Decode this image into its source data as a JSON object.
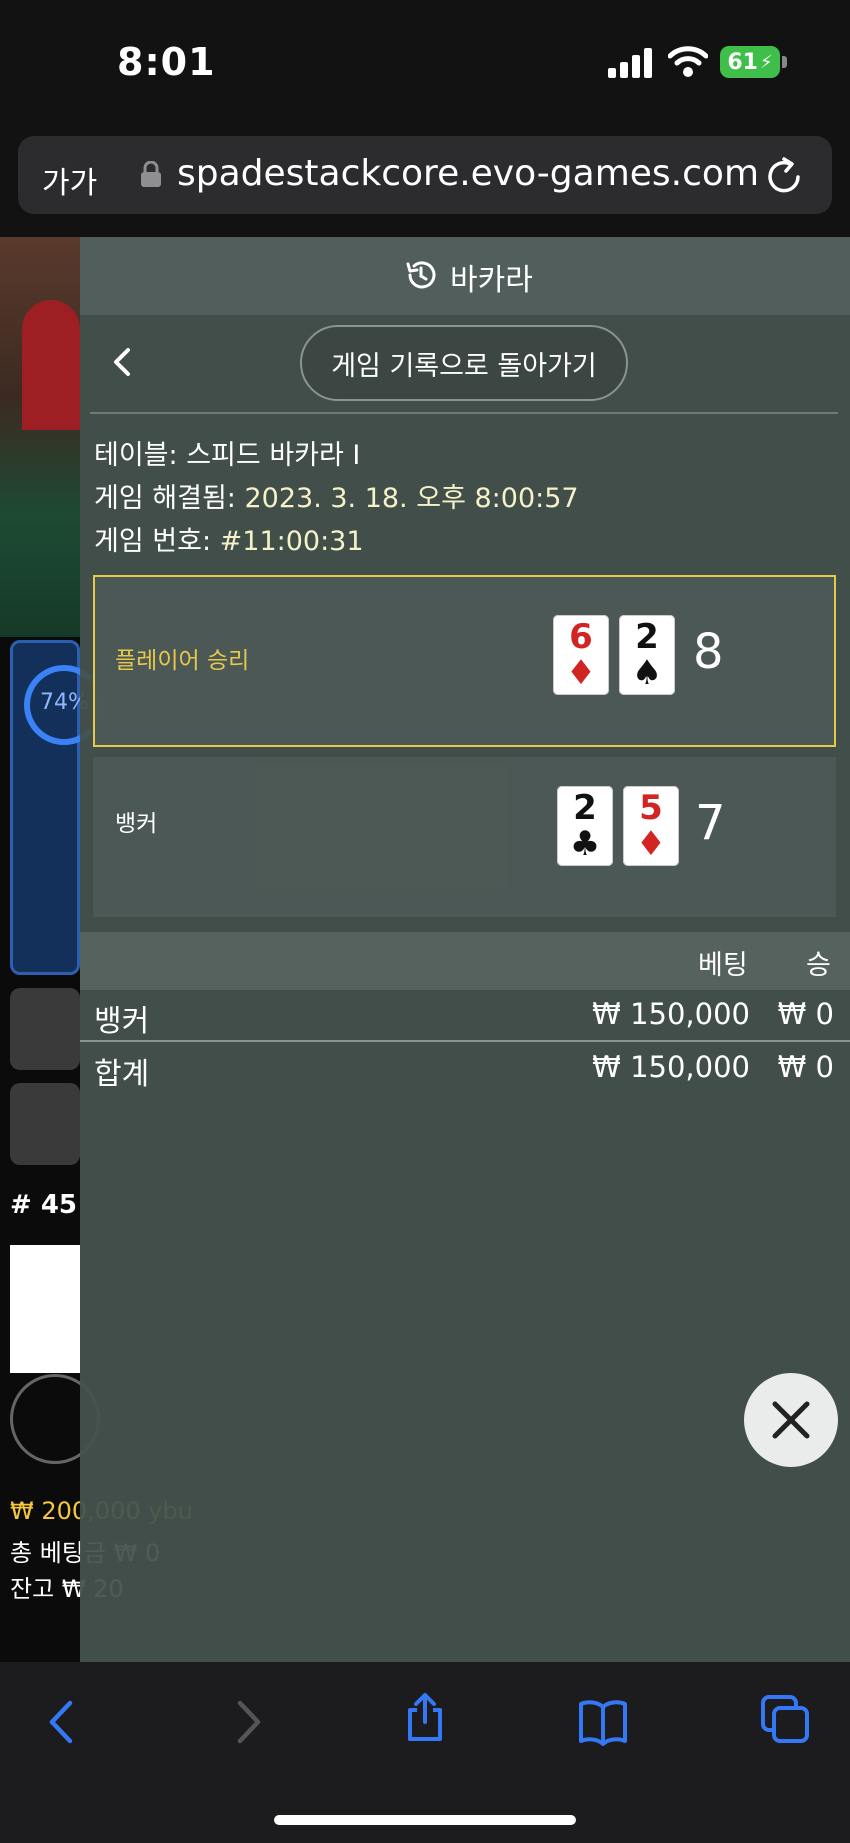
{
  "status_bar": {
    "time": "8:01",
    "battery": "61"
  },
  "browser": {
    "text_size": "가가",
    "url": "spadestackcore.evo-games.com"
  },
  "background": {
    "progress_percent": "74%",
    "round_number": "# 45",
    "balance_line1": "₩ 200,000 ybu",
    "balance_line2": "총 베팅금 ₩ 0",
    "balance_line3": "잔고 ₩ 20"
  },
  "panel": {
    "title": "바카라",
    "back_label": "게임 기록으로 돌아가기",
    "table_label": "테이블:",
    "table_value": "스피드 바카라 I",
    "resolved_label": "게임 해결됨:",
    "resolved_value": "2023. 3. 18. 오후 8:00:57",
    "number_label": "게임 번호:",
    "number_value": "#11:00:31"
  },
  "results": {
    "player": {
      "label": "플레이어 승리",
      "cards": [
        {
          "rank": "6",
          "suit": "♦"
        },
        {
          "rank": "2",
          "suit": "♠"
        }
      ],
      "score": "8"
    },
    "banker": {
      "label": "뱅커",
      "cards": [
        {
          "rank": "2",
          "suit": "♣"
        },
        {
          "rank": "5",
          "suit": "♦"
        }
      ],
      "score": "7"
    }
  },
  "bets": {
    "col_bet": "베팅",
    "col_win": "승",
    "rows": [
      {
        "name": "뱅커",
        "bet": "₩ 150,000",
        "win": "₩ 0"
      }
    ],
    "total": {
      "name": "합계",
      "bet": "₩ 150,000",
      "win": "₩ 0"
    }
  },
  "colors": {
    "accent_gold": "#e6c84a",
    "panel_bg": "#44524e",
    "link_blue": "#3478f6"
  },
  "icons": [
    "history-icon",
    "chevron-left-icon",
    "close-icon",
    "lock-icon",
    "reload-icon",
    "share-icon",
    "bookmarks-icon",
    "tabs-icon"
  ]
}
